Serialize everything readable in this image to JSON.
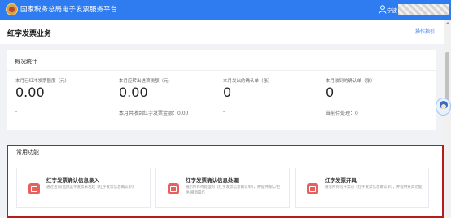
{
  "header": {
    "app_title": "国家税务总局电子发票服务平台",
    "user_prefix": "宁波"
  },
  "page": {
    "title": "红字发票业务",
    "guide_link": "操作指引"
  },
  "overview": {
    "title": "概况统计",
    "stats": [
      {
        "label": "本月已红冲发票额度（元）",
        "value": "0.00",
        "sub": "-"
      },
      {
        "label": "本月应转出进项税额（元）",
        "value": "0.00",
        "sub": "本月共收到红字发票金额：0.00"
      },
      {
        "label": "本月发出的确认单（张）",
        "value": "0",
        "sub": "-"
      },
      {
        "label": "本月收到的确认单（张）",
        "value": "0",
        "sub": "当前待处理：0"
      }
    ]
  },
  "common": {
    "title": "常用功能",
    "tiles": [
      {
        "title": "红字发票确认信息录入",
        "desc": "通过查询/选择蓝字发票来发起《红字发票信息确认单》",
        "icon": "invoice-entry-icon"
      },
      {
        "title": "红字发票确认信息处理",
        "desc": "展示所有待处理的《红字发票信息确认单》，并提供确认/拒绝/撤销操作",
        "icon": "invoice-process-icon"
      },
      {
        "title": "红字发票开具",
        "desc": "展示所有可开票的《红字发票信息确认单》，并提供开具功能",
        "icon": "invoice-issue-icon"
      }
    ]
  },
  "colors": {
    "topbar": "#2f7cf0",
    "highlight_border": "#b71c1c",
    "tile_icon": "#e8605e"
  }
}
